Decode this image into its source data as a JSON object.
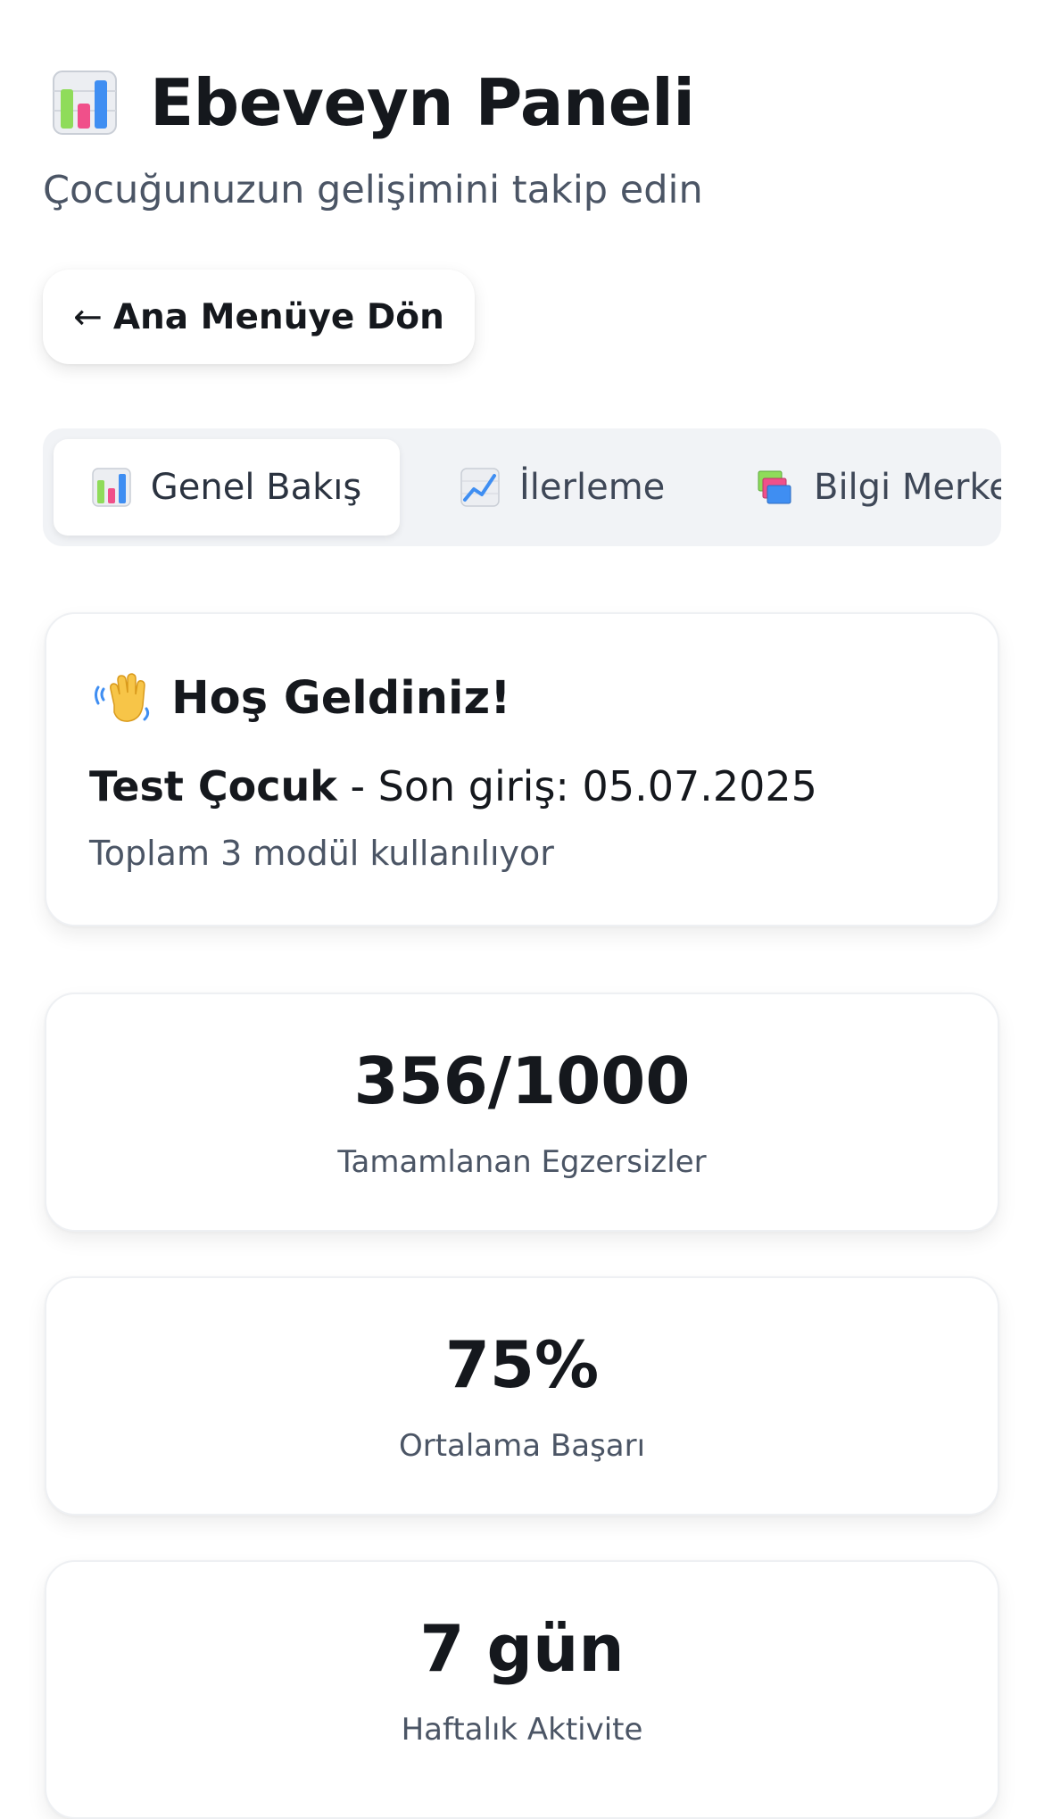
{
  "header": {
    "title": "Ebeveyn Paneli",
    "subtitle": "Çocuğunuzun gelişimini takip edin",
    "icon": "bar-chart-icon"
  },
  "back_button": {
    "arrow": "←",
    "label": "Ana Menüye Dön"
  },
  "tabs": [
    {
      "label": "Genel Bakış",
      "icon": "bar-chart-icon",
      "active": true
    },
    {
      "label": "İlerleme",
      "icon": "trend-up-icon",
      "active": false
    },
    {
      "label": "Bilgi Merkezi",
      "icon": "books-icon",
      "active": false
    }
  ],
  "welcome": {
    "title": "Hoş Geldiniz!",
    "icon": "waving-hand-icon",
    "child_name": "Test Çocuk",
    "last_login": " - Son giriş: 05.07.2025",
    "modules": "Toplam 3 modül kullanılıyor"
  },
  "stats": [
    {
      "value": "356/1000",
      "label": "Tamamlanan Egzersizler"
    },
    {
      "value": "75%",
      "label": "Ortalama Başarı"
    },
    {
      "value": "7 gün",
      "label": "Haftalık Aktivite"
    }
  ],
  "colors": {
    "background": "#ffffff",
    "text_primary": "#15181d",
    "text_secondary": "#4b5565",
    "tab_bar": "#f1f3f6"
  }
}
